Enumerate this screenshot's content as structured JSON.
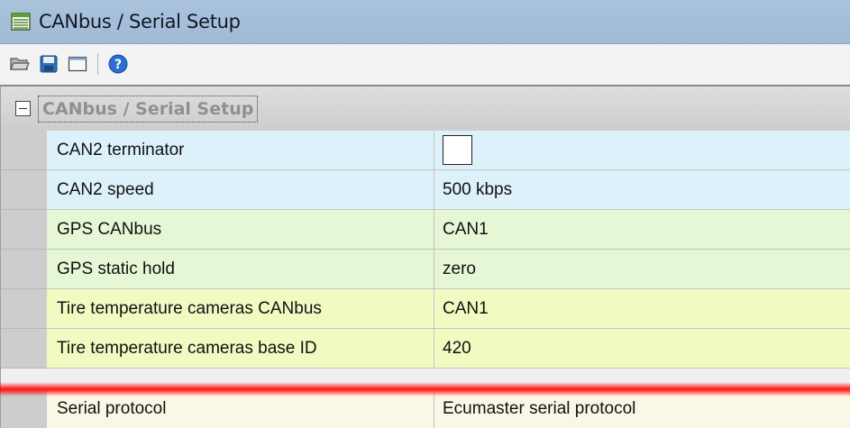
{
  "window": {
    "title": "CANbus / Serial Setup",
    "title_icon": "table-icon"
  },
  "toolbar": {
    "buttons": [
      {
        "name": "open-folder-icon",
        "icon": "folder"
      },
      {
        "name": "save-icon",
        "icon": "floppy"
      },
      {
        "name": "window-icon",
        "icon": "window"
      },
      {
        "name": "help-icon",
        "icon": "question"
      }
    ]
  },
  "grid": {
    "category": "CANbus / Serial Setup",
    "rows": [
      {
        "name": "CAN2 terminator",
        "value": "",
        "type": "checkbox",
        "checked": false,
        "color": "blue"
      },
      {
        "name": "CAN2 speed",
        "value": "500 kbps",
        "type": "text",
        "color": "blue"
      },
      {
        "name": "GPS CANbus",
        "value": "CAN1",
        "type": "text",
        "color": "green"
      },
      {
        "name": "GPS static hold",
        "value": "zero",
        "type": "text",
        "color": "green"
      },
      {
        "name": "Tire temperature cameras CANbus",
        "value": "CAN1",
        "type": "text",
        "color": "yellow"
      },
      {
        "name": "Tire temperature cameras base ID",
        "value": "420",
        "type": "text",
        "color": "yellow"
      },
      {
        "name": "Serial protocol",
        "value": "Ecumaster serial protocol",
        "type": "text",
        "color": "cream"
      }
    ]
  },
  "colors": {
    "titlebar": "#a0bad6",
    "row_blue": "#ddf1fb",
    "row_green": "#e6f7d6",
    "row_yellow": "#f2fac2",
    "row_cream": "#fbf7e6",
    "highlight": "#ff0000"
  }
}
